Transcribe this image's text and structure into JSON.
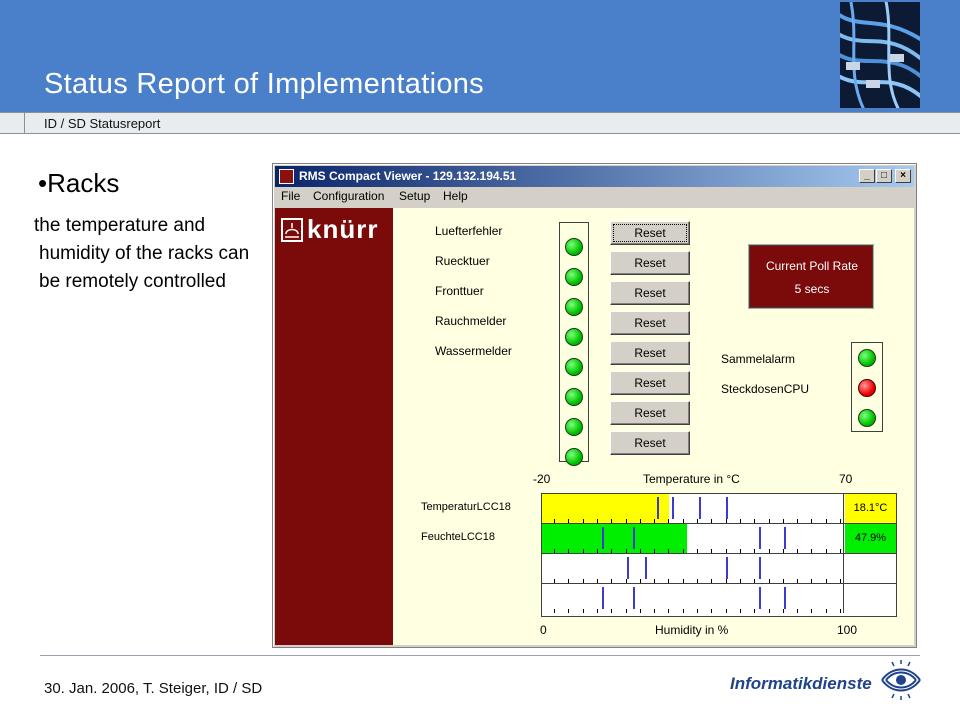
{
  "slide": {
    "title": "Status Report of Implementations",
    "subtitle": "ID / SD Statusreport",
    "bullet": "•Racks",
    "body": "the temperature and humidity of the racks can be remotely controlled",
    "footer": "30. Jan. 2006, T. Steiger, ID / SD",
    "footer_logo": "Informatikdienste"
  },
  "window": {
    "title": "RMS Compact Viewer - 129.132.194.51",
    "controls": {
      "minimize": "_",
      "maximize": "□",
      "close": "×"
    },
    "menu": [
      "File",
      "Configuration",
      "Setup",
      "Help"
    ]
  },
  "brand": {
    "name": "knürr"
  },
  "sensors": [
    {
      "label": "Luefterfehler",
      "status": "green",
      "button": "Reset"
    },
    {
      "label": "Ruecktuer",
      "status": "green",
      "button": "Reset"
    },
    {
      "label": "Fronttuer",
      "status": "green",
      "button": "Reset"
    },
    {
      "label": "Rauchmelder",
      "status": "green",
      "button": "Reset"
    },
    {
      "label": "Wassermelder",
      "status": "green",
      "button": "Reset"
    },
    {
      "label": "",
      "status": "green",
      "button": "Reset"
    },
    {
      "label": "",
      "status": "green",
      "button": "Reset"
    },
    {
      "label": "",
      "status": "green",
      "button": "Reset"
    }
  ],
  "poll_rate": {
    "title": "Current Poll Rate",
    "value": "5 secs"
  },
  "alarms": [
    {
      "label": "Sammelalarm",
      "status": "green"
    },
    {
      "label": "SteckdosenCPU",
      "status": "red"
    },
    {
      "label": "",
      "status": "green"
    }
  ],
  "temperature_axis": {
    "min": "-20",
    "title": "Temperature in °C",
    "max": "70",
    "range": [
      -20,
      70
    ]
  },
  "humidity_axis": {
    "min": "0",
    "title": "Humidity in %",
    "max": "100",
    "range": [
      0,
      100
    ]
  },
  "gauges": [
    {
      "label": "TemperaturLCC18",
      "readout": "18.1°C",
      "fill_fraction": 0.42,
      "fill_color": "#ffff00",
      "markers": [
        0.38,
        0.43,
        0.52,
        0.61
      ]
    },
    {
      "label": "FeuchteLCC18",
      "readout": "47.9%",
      "fill_fraction": 0.479,
      "fill_color": "#00ee00",
      "markers": [
        0.2,
        0.3,
        0.72,
        0.8
      ]
    },
    {
      "label": "",
      "readout": "",
      "fill_fraction": 0,
      "fill_color": "#ffffff",
      "markers": [
        0.28,
        0.34,
        0.61,
        0.72
      ]
    },
    {
      "label": "",
      "readout": "",
      "fill_fraction": 0,
      "fill_color": "#ffffff",
      "markers": [
        0.2,
        0.3,
        0.72,
        0.8
      ]
    }
  ],
  "colors": {
    "header_blue": "#4a7fc9",
    "brand_red": "#7b0a0a",
    "client_bg": "#ffffe1"
  }
}
